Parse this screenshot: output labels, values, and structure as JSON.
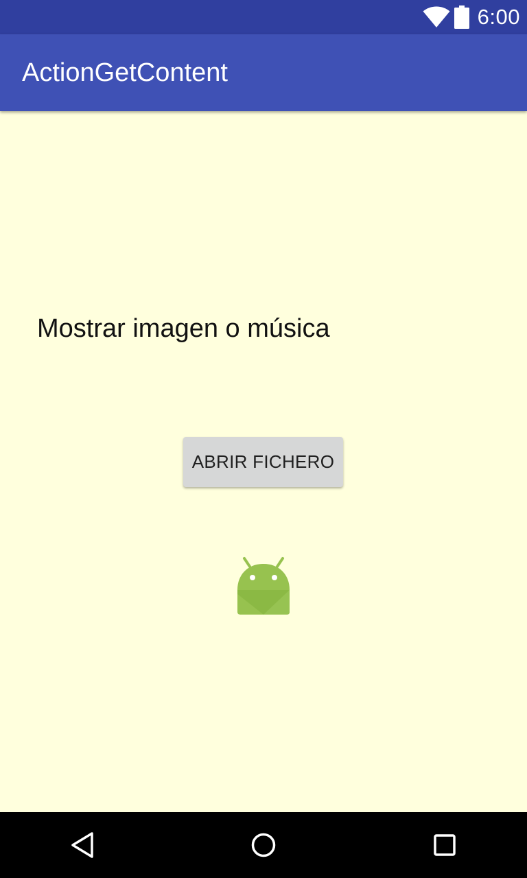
{
  "status_bar": {
    "time": "6:00",
    "icons": [
      "wifi-icon",
      "battery-icon"
    ],
    "background": "#303F9F"
  },
  "app_bar": {
    "title": "ActionGetContent",
    "background": "#3F51B5"
  },
  "main": {
    "background": "#FFFFDD",
    "prompt_text": "Mostrar imagen o música",
    "open_button_label": "ABRIR FICHERO",
    "image_icon": "android-robot-icon"
  },
  "nav_bar": {
    "buttons": [
      "back-icon",
      "home-icon",
      "recents-icon"
    ],
    "background": "#000000"
  }
}
